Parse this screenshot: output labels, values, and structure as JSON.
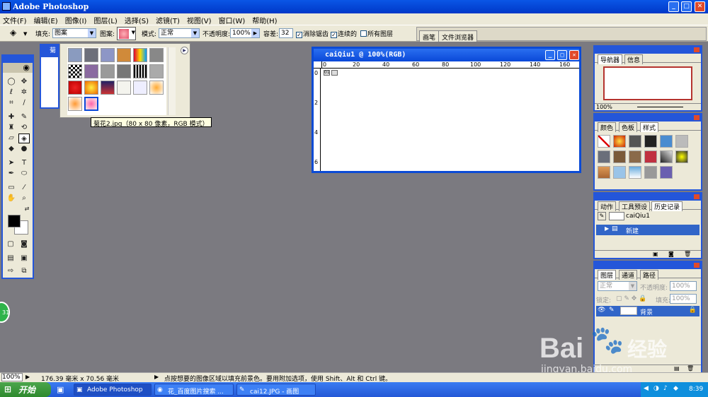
{
  "window": {
    "title": "Adobe Photoshop",
    "min": "_",
    "max": "□",
    "close": "✕"
  },
  "menu": [
    "文件(F)",
    "编辑(E)",
    "图像(I)",
    "图层(L)",
    "选择(S)",
    "滤镜(T)",
    "视图(V)",
    "窗口(W)",
    "帮助(H)"
  ],
  "options": {
    "fill_label": "填充:",
    "fill_value": "图案",
    "pattern_label": "图案:",
    "mode_label": "模式:",
    "mode_value": "正常",
    "opacity_label": "不透明度:",
    "opacity_value": "100%",
    "tolerance_label": "容差:",
    "tolerance_value": "32",
    "antialias_label": "消除锯齿",
    "antialias_checked": true,
    "contiguous_label": "连续的",
    "contiguous_checked": true,
    "all_layers_label": "所有图层",
    "all_layers_checked": false,
    "well_tabs": [
      "画笔",
      "文件浏览器"
    ]
  },
  "tooltip": "菊花2.jpg（80 x 80 像素，RGB 模式）",
  "document": {
    "title": "caiQiu1 @ 100%(RGB)",
    "ruler_h": [
      "0",
      "20",
      "40",
      "60",
      "80",
      "100",
      "120",
      "140",
      "160"
    ],
    "ruler_v": [
      "0",
      "2",
      "4",
      "6"
    ]
  },
  "bg_doc_tab": "菊",
  "navigator": {
    "tabs": [
      "导航器",
      "信息"
    ],
    "zoom": "100%",
    "accent": "#b5332e"
  },
  "styles": {
    "tabs": [
      "颜色",
      "色板",
      "样式"
    ]
  },
  "history": {
    "tabs": [
      "动作",
      "工具预设",
      "历史记录"
    ],
    "snapshot": "caiQiu1",
    "step": "新建"
  },
  "layers": {
    "tabs": [
      "图层",
      "通道",
      "路径"
    ],
    "blend_mode": "正常",
    "opacity_label": "不透明度:",
    "opacity_value": "100%",
    "lock_label": "锁定:",
    "fill_label": "填充:",
    "fill_value": "100%",
    "layer_name": "背景"
  },
  "status": {
    "zoom": "100%",
    "size": "176.39 毫米 x 70.56 毫米",
    "hint": "点按想要的图像区域以填充前景色。要用附加选项，使用 Shift、Alt 和 Ctrl 键。"
  },
  "taskbar": {
    "start": "开始",
    "tasks": [
      "Adobe Photoshop",
      "花_百度图片搜索 ...",
      "cai12.JPG - 画图"
    ],
    "clock": "8:39"
  },
  "overlay": {
    "green_badge": "31"
  },
  "watermark": {
    "brand": "Bai",
    "brand_cn": "经验",
    "url": "jingyan.baidu.com"
  }
}
